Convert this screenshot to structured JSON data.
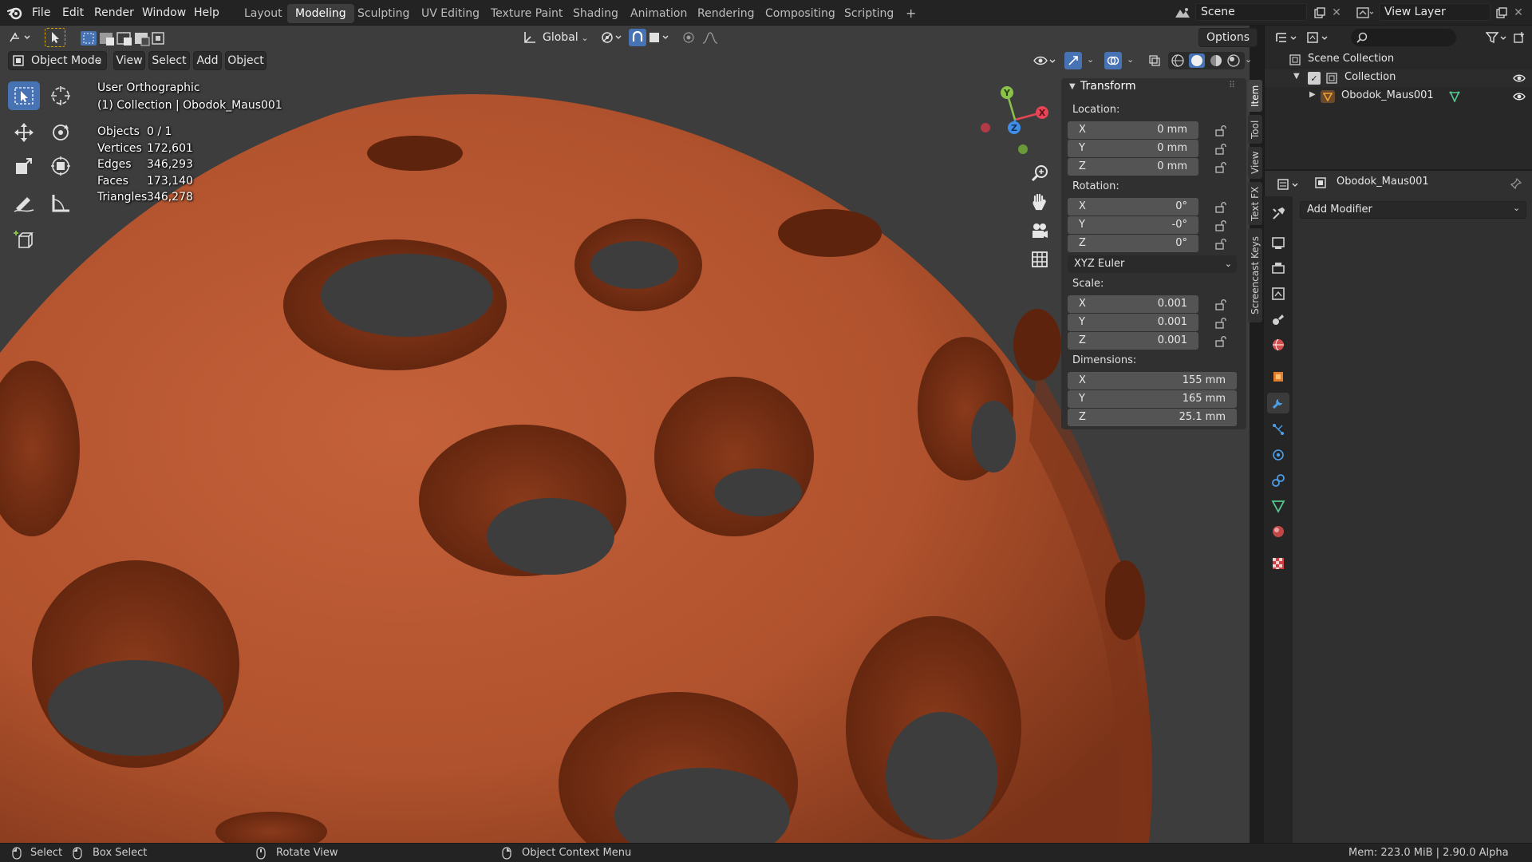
{
  "topbar": {
    "menus": [
      "File",
      "Edit",
      "Render",
      "Window",
      "Help"
    ],
    "workspaces": [
      "Layout",
      "Modeling",
      "Sculpting",
      "UV Editing",
      "Texture Paint",
      "Shading",
      "Animation",
      "Rendering",
      "Compositing",
      "Scripting"
    ],
    "active_workspace": "Modeling",
    "add_workspace": "+",
    "scene_name": "Scene",
    "view_layer_name": "View Layer"
  },
  "viewport_header": {
    "transform_orientation": "Global",
    "options_label": "Options",
    "mode_label": "Object Mode",
    "menus": [
      "View",
      "Select",
      "Add",
      "Object"
    ]
  },
  "viewport_overlay": {
    "view_name": "User Orthographic",
    "collection_line": "(1) Collection | Obodok_Maus001",
    "stats": [
      {
        "label": "Objects",
        "value": "0 / 1"
      },
      {
        "label": "Vertices",
        "value": "172,601"
      },
      {
        "label": "Edges",
        "value": "346,293"
      },
      {
        "label": "Faces",
        "value": "173,140"
      },
      {
        "label": "Triangles",
        "value": "346,278"
      }
    ]
  },
  "gizmo": {
    "x": "X",
    "y": "Y",
    "z": "Z"
  },
  "transform_panel": {
    "title": "Transform",
    "location_label": "Location:",
    "location": [
      {
        "axis": "X",
        "value": "0 mm"
      },
      {
        "axis": "Y",
        "value": "0 mm"
      },
      {
        "axis": "Z",
        "value": "0 mm"
      }
    ],
    "rotation_label": "Rotation:",
    "rotation": [
      {
        "axis": "X",
        "value": "0°"
      },
      {
        "axis": "Y",
        "value": "-0°"
      },
      {
        "axis": "Z",
        "value": "0°"
      }
    ],
    "rotation_mode": "XYZ Euler",
    "scale_label": "Scale:",
    "scale": [
      {
        "axis": "X",
        "value": "0.001"
      },
      {
        "axis": "Y",
        "value": "0.001"
      },
      {
        "axis": "Z",
        "value": "0.001"
      }
    ],
    "dimensions_label": "Dimensions:",
    "dimensions": [
      {
        "axis": "X",
        "value": "155 mm"
      },
      {
        "axis": "Y",
        "value": "165 mm"
      },
      {
        "axis": "Z",
        "value": "25.1 mm"
      }
    ]
  },
  "side_tabs": [
    "Item",
    "Tool",
    "View",
    "Text FX",
    "Screencast Keys"
  ],
  "outliner": {
    "scene_collection": "Scene Collection",
    "collection": "Collection",
    "object": "Obodok_Maus001"
  },
  "properties": {
    "object_name": "Obodok_Maus001",
    "add_modifier": "Add Modifier"
  },
  "statusbar": {
    "select": "Select",
    "box_select": "Box Select",
    "rotate_view": "Rotate View",
    "context_menu": "Object Context Menu",
    "mem": "Mem: 223.0 MiB | 2.90.0 Alpha"
  },
  "colors": {
    "accent": "#4772b3",
    "mesh": "#b5562f",
    "axis_x": "#e64555",
    "axis_y": "#8bc34a",
    "axis_z": "#3f8fe6"
  }
}
